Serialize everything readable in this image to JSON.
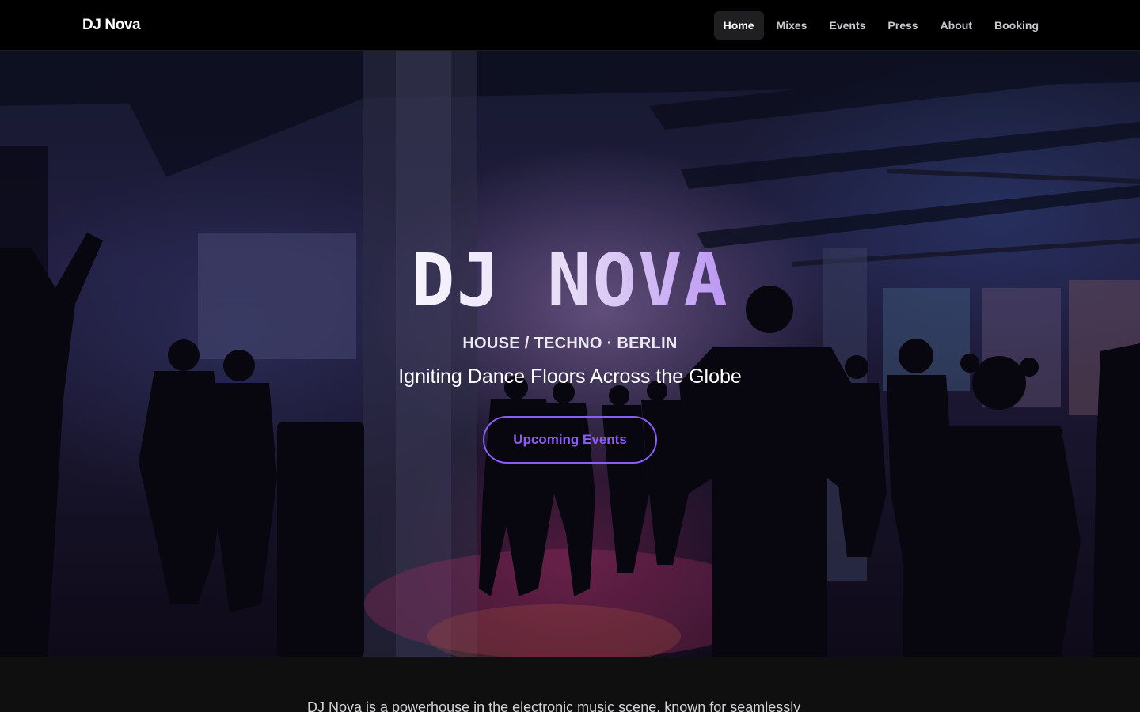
{
  "nav": {
    "brand": "DJ Nova",
    "links": [
      {
        "label": "Home",
        "active": true
      },
      {
        "label": "Mixes",
        "active": false
      },
      {
        "label": "Events",
        "active": false
      },
      {
        "label": "Press",
        "active": false
      },
      {
        "label": "About",
        "active": false
      },
      {
        "label": "Booking",
        "active": false
      }
    ]
  },
  "hero": {
    "title": "DJ NOVA",
    "genres": "HOUSE / TECHNO · BERLIN",
    "tagline": "Igniting Dance Floors Across the Globe",
    "cta_label": "Upcoming Events"
  },
  "bio": {
    "text": "DJ Nova is a powerhouse in the electronic music scene, known for seamlessly"
  },
  "colors": {
    "accent": "#8b5cf6",
    "nav_background": "#000000",
    "page_background": "#0f0f10"
  }
}
